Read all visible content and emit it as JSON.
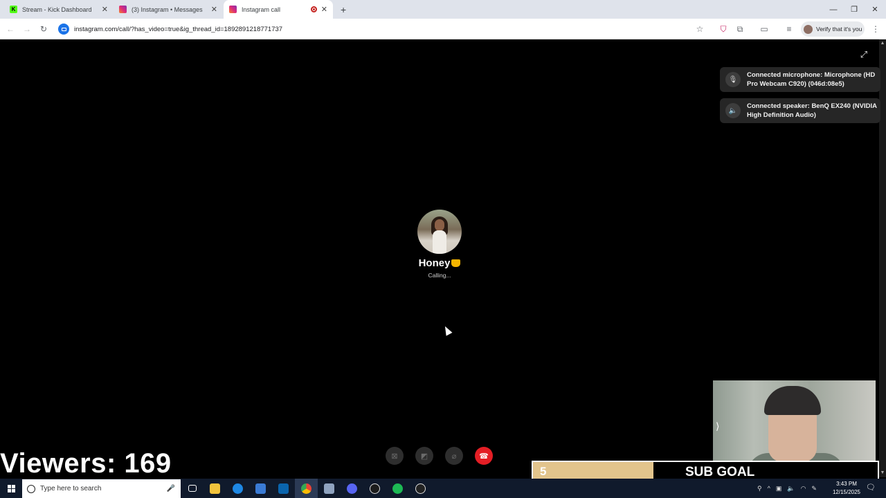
{
  "browser": {
    "tabs": [
      {
        "title": "Stream - Kick Dashboard",
        "favicon": "kick-icon",
        "color": "#53fc18"
      },
      {
        "title": "(3) Instagram • Messages",
        "favicon": "instagram-icon",
        "color": "#d6249f"
      },
      {
        "title": "Instagram call",
        "favicon": "instagram-icon",
        "color": "#d6249f",
        "recording": true
      }
    ],
    "new_tab": "+",
    "url": "instagram.com/call/?has_video=true&ig_thread_id=1892891218771737",
    "verify_label": "Verify that it's you"
  },
  "call": {
    "devices": [
      {
        "icon": "microphone-icon",
        "text": "Connected microphone: Microphone (HD Pro Webcam C920) (046d:08e5)"
      },
      {
        "icon": "speaker-icon",
        "text": "Connected speaker: BenQ EX240 (NVIDIA High Definition Audio)"
      }
    ],
    "callee": {
      "name": "Honey",
      "name_icon": "honey-pot-icon",
      "status": "Calling..."
    },
    "controls": [
      "effects-icon",
      "camera-off-icon",
      "mic-off-icon",
      "end-call-icon"
    ],
    "end_call_color": "#e41e25"
  },
  "overlay": {
    "viewers": "Viewers: 169",
    "sub_goal": {
      "count": "5",
      "label": "SUB GOAL",
      "progress": 0.35,
      "fill_color": "#e2c48c"
    }
  },
  "taskbar": {
    "search_placeholder": "Type here to search",
    "apps": [
      "task-view-icon",
      "file-explorer-icon",
      "edge-icon",
      "store-icon",
      "mail-icon",
      "chrome-icon",
      "app-icon",
      "discord-icon",
      "app2-icon",
      "spotify-icon",
      "app3-icon"
    ],
    "time": "3:43 PM",
    "date": "12/15/2025"
  }
}
